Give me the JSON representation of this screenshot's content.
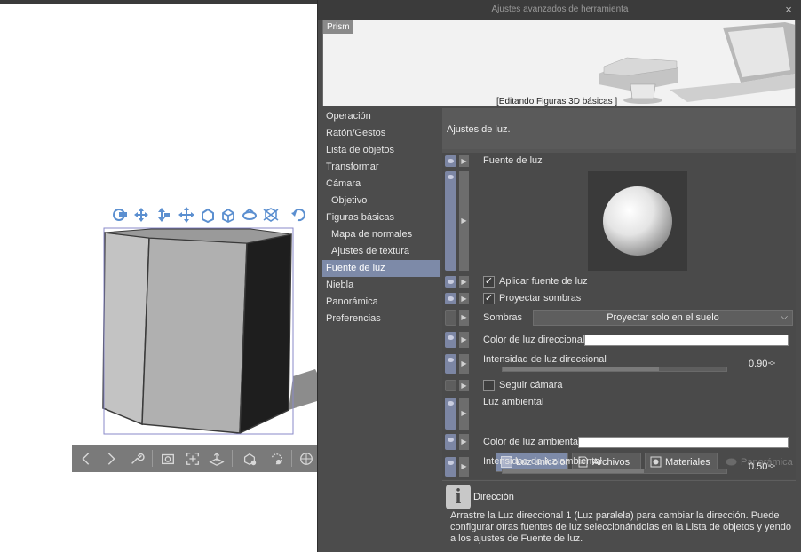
{
  "dialog": {
    "title": "Ajustes avanzados de herramienta",
    "close_glyph": "×"
  },
  "preview": {
    "tag": "Prism",
    "caption": "[Editando Figuras 3D básicas ]"
  },
  "sidebar": {
    "items": [
      {
        "label": "Operación",
        "sub": false,
        "active": false
      },
      {
        "label": "Ratón/Gestos",
        "sub": false,
        "active": false
      },
      {
        "label": "Lista de objetos",
        "sub": false,
        "active": false
      },
      {
        "label": "Transformar",
        "sub": false,
        "active": false
      },
      {
        "label": "Cámara",
        "sub": false,
        "active": false
      },
      {
        "label": "Objetivo",
        "sub": true,
        "active": false
      },
      {
        "label": "Figuras básicas",
        "sub": false,
        "active": false
      },
      {
        "label": "Mapa de normales",
        "sub": true,
        "active": false
      },
      {
        "label": "Ajustes de textura",
        "sub": true,
        "active": false
      },
      {
        "label": "Fuente de luz",
        "sub": false,
        "active": true
      },
      {
        "label": "Niebla",
        "sub": false,
        "active": false
      },
      {
        "label": "Panorámica",
        "sub": false,
        "active": false
      },
      {
        "label": "Preferencias",
        "sub": false,
        "active": false
      }
    ]
  },
  "main": {
    "header": "Ajustes de luz.",
    "light_source_label": "Fuente de luz",
    "apply_light": {
      "label": "Aplicar fuente de luz",
      "checked": true
    },
    "cast_shadows": {
      "label": "Proyectar sombras",
      "checked": true
    },
    "shadows": {
      "label": "Sombras",
      "value": "Proyectar solo en el suelo"
    },
    "directional_color_label": "Color de luz direccional",
    "directional_color": "#ffffff",
    "directional_intensity": {
      "label": "Intensidad de luz direccional",
      "value": "0.90",
      "fraction": 0.7
    },
    "follow_camera": {
      "label": "Seguir cámara",
      "checked": false
    },
    "ambient_label": "Luz ambiental",
    "ambient_modes": [
      {
        "label": "Luz unicolor",
        "state": "active",
        "icon": "solid-square-icon"
      },
      {
        "label": "Archivos",
        "state": "normal",
        "icon": "file-icon"
      },
      {
        "label": "Materiales",
        "state": "normal",
        "icon": "material-icon"
      },
      {
        "label": "Panorámica",
        "state": "disabled",
        "icon": "panorama-icon"
      }
    ],
    "ambient_color_label": "Color de luz ambiental",
    "ambient_color": "#ffffff",
    "ambient_intensity": {
      "label": "Intensidad de luz ambiental",
      "value": "0.50",
      "fraction": 0.63
    }
  },
  "info": {
    "icon": "i",
    "title": "Dirección",
    "text": "Arrastre la Luz direccional 1 (Luz paralela) para cambiar la dirección. Puede configurar otras fuentes de luz seleccionándolas en la Lista de objetos y yendo a los ajustes de Fuente de luz."
  },
  "colors": {
    "accent": "#7d8aa8",
    "icon_blue": "#5b8fd0",
    "panel": "#4c4c4c"
  }
}
